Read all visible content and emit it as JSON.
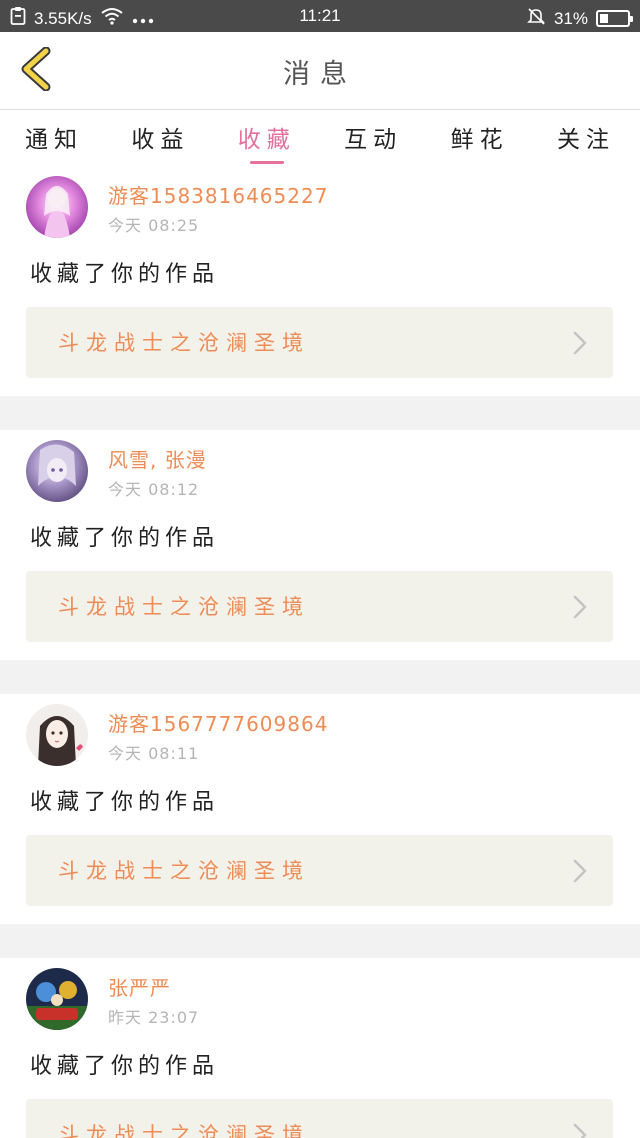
{
  "status_bar": {
    "net_speed": "3.55K/s",
    "time": "11:21",
    "battery": "31%",
    "battery_level": 0.31
  },
  "header": {
    "title": "消息",
    "back_icon": "chevron-left-icon",
    "accent_color": "#f3d34a"
  },
  "tabs": [
    {
      "label": "通知"
    },
    {
      "label": "收益"
    },
    {
      "label": "收藏"
    },
    {
      "label": "互动"
    },
    {
      "label": "鲜花"
    },
    {
      "label": "关注"
    }
  ],
  "active_tab": "收藏",
  "colors": {
    "active_tab": "#e4709b",
    "username": "#ee8c55",
    "work_title": "#ee8c55",
    "work_box": "#f2f1ea"
  },
  "feed": [
    {
      "username": "游客1583816465227",
      "time": "今天 08:25",
      "action": "收藏了你的作品",
      "work_title": "斗龙战士之沧澜圣境"
    },
    {
      "username": "风雪, 张漫",
      "time": "今天 08:12",
      "action": "收藏了你的作品",
      "work_title": "斗龙战士之沧澜圣境"
    },
    {
      "username": "游客1567777609864",
      "time": "今天 08:11",
      "action": "收藏了你的作品",
      "work_title": "斗龙战士之沧澜圣境"
    },
    {
      "username": "张严严",
      "time": "昨天 23:07",
      "action": "收藏了你的作品",
      "work_title": "斗龙战士之沧澜圣境"
    }
  ]
}
